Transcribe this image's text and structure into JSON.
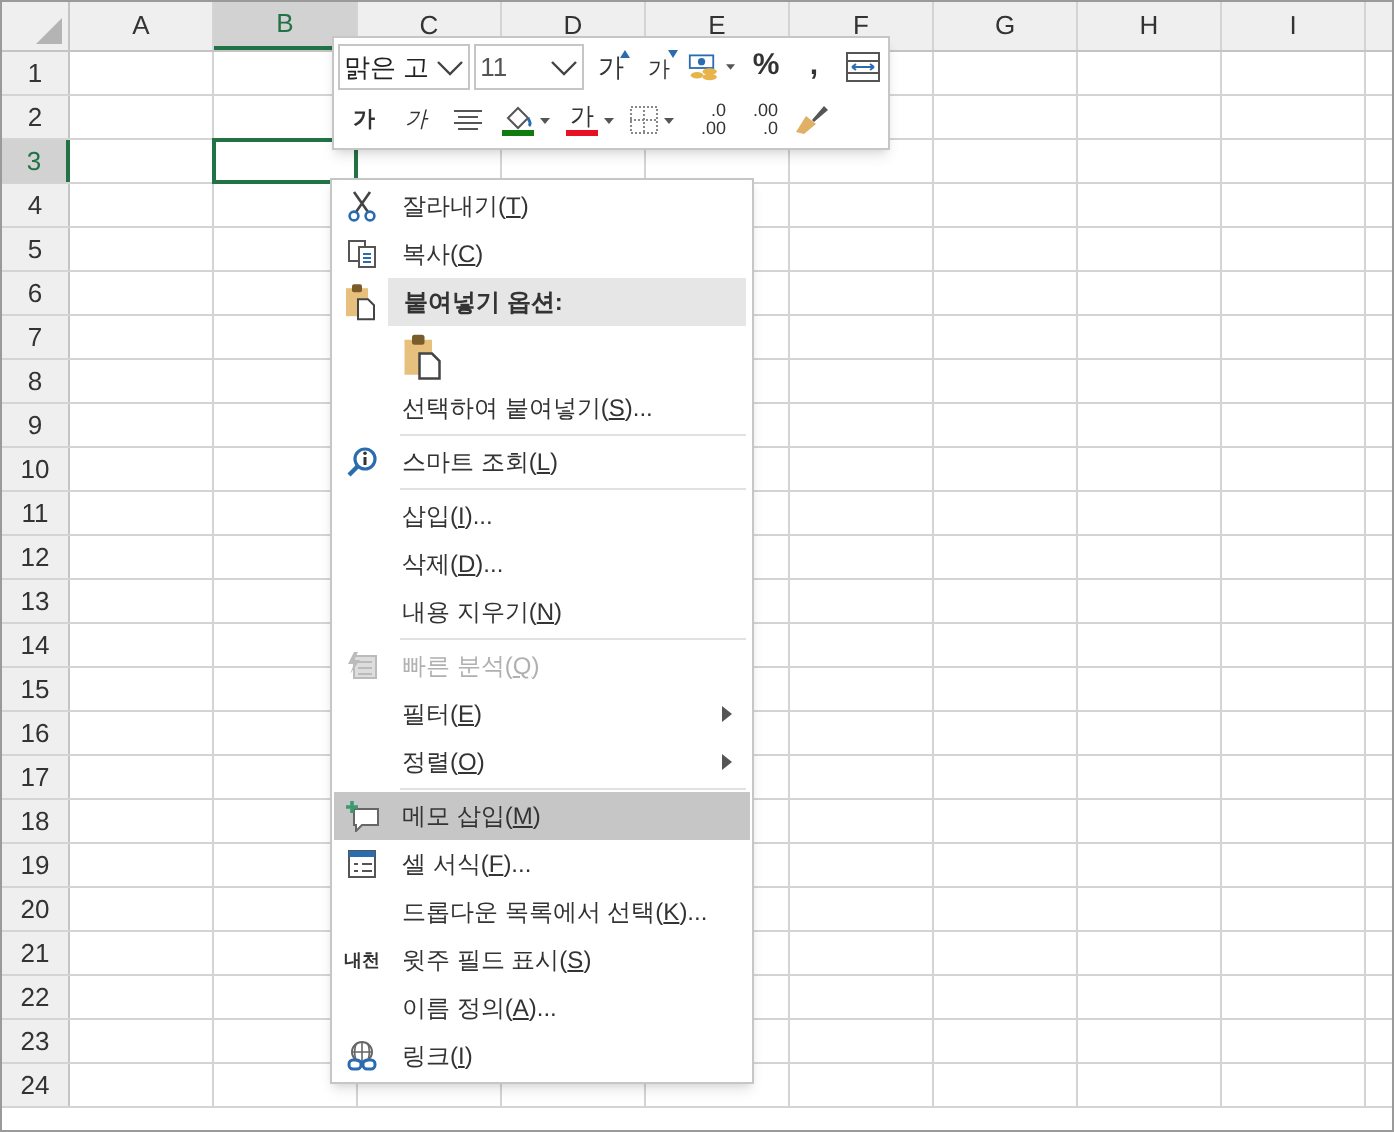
{
  "sheet": {
    "columns": [
      {
        "label": "A",
        "selected": false
      },
      {
        "label": "B",
        "selected": true
      },
      {
        "label": "C",
        "selected": false
      },
      {
        "label": "D",
        "selected": false
      },
      {
        "label": "E",
        "selected": false
      },
      {
        "label": "F",
        "selected": false
      },
      {
        "label": "G",
        "selected": false
      },
      {
        "label": "H",
        "selected": false
      },
      {
        "label": "I",
        "selected": false
      }
    ],
    "rows": [
      {
        "label": "1",
        "selected": false
      },
      {
        "label": "2",
        "selected": false
      },
      {
        "label": "3",
        "selected": true
      },
      {
        "label": "4",
        "selected": false
      },
      {
        "label": "5",
        "selected": false
      },
      {
        "label": "6",
        "selected": false
      },
      {
        "label": "7",
        "selected": false
      },
      {
        "label": "8",
        "selected": false
      },
      {
        "label": "9",
        "selected": false
      },
      {
        "label": "10",
        "selected": false
      },
      {
        "label": "11",
        "selected": false
      },
      {
        "label": "12",
        "selected": false
      },
      {
        "label": "13",
        "selected": false
      },
      {
        "label": "14",
        "selected": false
      },
      {
        "label": "15",
        "selected": false
      },
      {
        "label": "16",
        "selected": false
      },
      {
        "label": "17",
        "selected": false
      },
      {
        "label": "18",
        "selected": false
      },
      {
        "label": "19",
        "selected": false
      },
      {
        "label": "20",
        "selected": false
      },
      {
        "label": "21",
        "selected": false
      },
      {
        "label": "22",
        "selected": false
      },
      {
        "label": "23",
        "selected": false
      },
      {
        "label": "24",
        "selected": false
      }
    ]
  },
  "mini_toolbar": {
    "top_row": [
      {
        "kind": "font-name",
        "value": "맑은 고"
      },
      {
        "kind": "font-size",
        "value": "11"
      },
      {
        "kind": "grow",
        "text": "가"
      },
      {
        "kind": "shrink",
        "text": "가"
      },
      {
        "kind": "accounting"
      },
      {
        "kind": "percent",
        "text": "%"
      },
      {
        "kind": "comma",
        "text": ","
      },
      {
        "kind": "merge"
      }
    ],
    "bottom_row": [
      {
        "kind": "bold",
        "text": "가"
      },
      {
        "kind": "italic",
        "text": "가"
      },
      {
        "kind": "align"
      },
      {
        "kind": "fill-color",
        "color": "#107c10"
      },
      {
        "kind": "font-color",
        "text": "가",
        "color": "#e81123"
      },
      {
        "kind": "borders"
      },
      {
        "kind": "increase-decimal",
        "top": ".0",
        "bottom": ".00"
      },
      {
        "kind": "decrease-decimal",
        "top": ".00",
        "bottom": ".0"
      },
      {
        "kind": "painter"
      }
    ]
  },
  "context_menu": {
    "items": [
      {
        "kind": "command",
        "before": "잘라내기(",
        "key": "T",
        "after": ")",
        "disabled": false,
        "submenu": false,
        "selected": false
      },
      {
        "kind": "command",
        "before": "복사(",
        "key": "C",
        "after": ")",
        "disabled": false,
        "submenu": false,
        "selected": false
      },
      {
        "kind": "header",
        "before": "붙여넣기 옵션:"
      },
      {
        "kind": "paste-option"
      },
      {
        "kind": "command",
        "before": "선택하여 붙여넣기(",
        "key": "S",
        "after": ")...",
        "disabled": false,
        "submenu": false,
        "selected": false
      },
      {
        "kind": "separator"
      },
      {
        "kind": "command",
        "before": "스마트 조회(",
        "key": "L",
        "after": ")",
        "disabled": false,
        "submenu": false,
        "selected": false
      },
      {
        "kind": "separator"
      },
      {
        "kind": "command",
        "before": "삽입(",
        "key": "I",
        "after": ")...",
        "disabled": false,
        "submenu": false,
        "selected": false
      },
      {
        "kind": "command",
        "before": "삭제(",
        "key": "D",
        "after": ")...",
        "disabled": false,
        "submenu": false,
        "selected": false
      },
      {
        "kind": "command",
        "before": "내용 지우기(",
        "key": "N",
        "after": ")",
        "disabled": false,
        "submenu": false,
        "selected": false
      },
      {
        "kind": "separator"
      },
      {
        "kind": "command",
        "before": "빠른 분석(",
        "key": "Q",
        "after": ")",
        "disabled": true,
        "submenu": false,
        "selected": false
      },
      {
        "kind": "command",
        "before": "필터(",
        "key": "E",
        "after": ")",
        "disabled": false,
        "submenu": true,
        "selected": false
      },
      {
        "kind": "command",
        "before": "정렬(",
        "key": "O",
        "after": ")",
        "disabled": false,
        "submenu": true,
        "selected": false
      },
      {
        "kind": "separator"
      },
      {
        "kind": "command",
        "before": "메모 삽입(",
        "key": "M",
        "after": ")",
        "disabled": false,
        "submenu": false,
        "selected": true
      },
      {
        "kind": "command",
        "before": "셀 서식(",
        "key": "F",
        "after": ")...",
        "disabled": false,
        "submenu": false,
        "selected": false
      },
      {
        "kind": "command",
        "before": "드롭다운 목록에서 선택(",
        "key": "K",
        "after": ")...",
        "disabled": false,
        "submenu": false,
        "selected": false
      },
      {
        "kind": "command",
        "before": "윗주 필드 표시(",
        "key": "S",
        "after": ")",
        "disabled": false,
        "submenu": false,
        "selected": false,
        "badge": "내천"
      },
      {
        "kind": "command",
        "before": "이름 정의(",
        "key": "A",
        "after": ")...",
        "disabled": false,
        "submenu": false,
        "selected": false
      },
      {
        "kind": "command",
        "before": "링크(",
        "key": "I",
        "after": ")",
        "disabled": false,
        "submenu": false,
        "selected": false
      }
    ]
  }
}
